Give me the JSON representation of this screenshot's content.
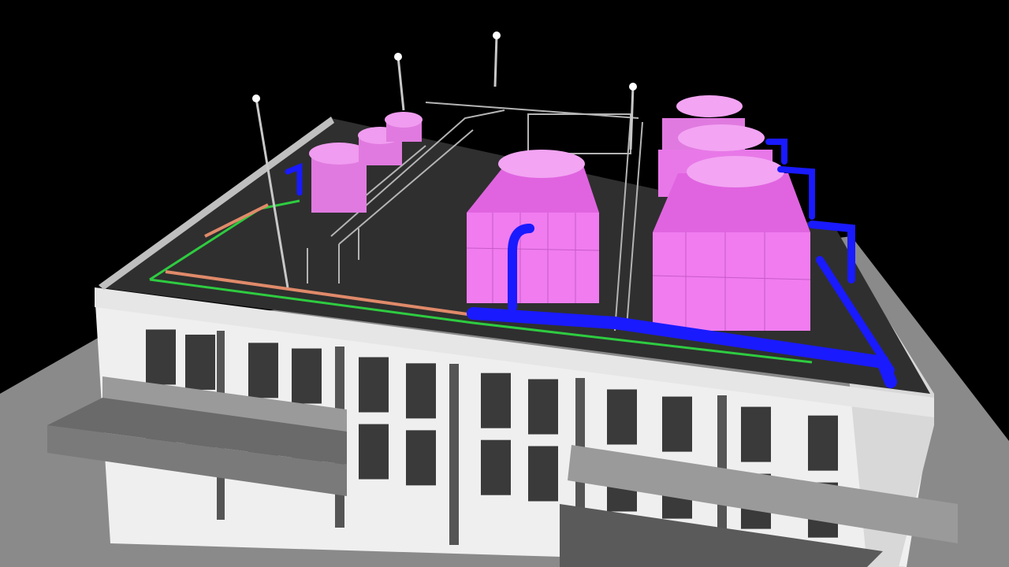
{
  "viewport": {
    "background": "#000000",
    "content": "3d-bim-model-rooftop-mep"
  },
  "colors": {
    "background": "#000000",
    "ground": "#8a8a8a",
    "wall": "#efefef",
    "louver": "#3a3a3a",
    "roof": "#2f2f2f",
    "parapet": "#e6e6e6",
    "cooling_tower": "#f07cf0",
    "cooling_tower_dark": "#c85ac8",
    "chilled_water_pipe": "#1a1aff",
    "condenser_pipe": "#e08a6a",
    "green_conduit": "#2ecc40",
    "steel_frame": "#b4b4b4",
    "light_pole": "#c8c8c8"
  },
  "objects": {
    "cooling_towers": 7,
    "light_poles": 5,
    "canopies": 2
  }
}
